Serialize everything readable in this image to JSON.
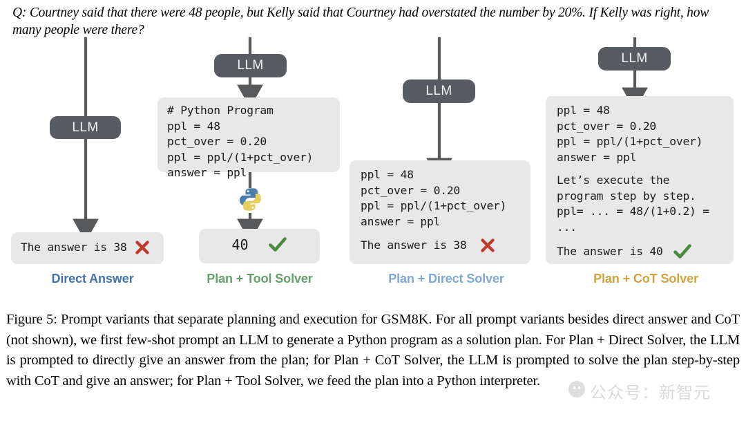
{
  "question": "Q: Courtney said that there were 48 people, but Kelly said that Courtney had overstated the number by 20%. If Kelly was right, how many people were there?",
  "llm_label": "LLM",
  "colors": {
    "llm_pill": "#585c60",
    "box_bg": "#e8e8e8",
    "arrow": "#58595b",
    "cross": "#c0392b",
    "check": "#4a8a3d",
    "direct_answer_label": "#4273b0",
    "tool_solver_label": "#64a06a",
    "direct_solver_label": "#7fa8d4",
    "cot_solver_label": "#d3a23c"
  },
  "columns": [
    {
      "id": "direct-answer",
      "label": "Direct Answer",
      "label_color": "#4273b0",
      "llm": "LLM",
      "answer_text": "The answer is 38",
      "mark": "cross"
    },
    {
      "id": "plan-tool-solver",
      "label": "Plan + Tool Solver",
      "label_color": "#64a06a",
      "llm": "LLM",
      "code_lines": [
        "# Python Program",
        "ppl = 48",
        "pct_over = 0.20",
        "ppl = ppl/(1+pct_over)",
        "answer = ppl"
      ],
      "tool_icon": "python-logo-icon",
      "answer_text": "40",
      "mark": "check"
    },
    {
      "id": "plan-direct-solver",
      "label": "Plan + Direct Solver",
      "label_color": "#7fa8d4",
      "llm": "LLM",
      "code_lines": [
        "ppl = 48",
        "pct_over = 0.20",
        "ppl = ppl/(1+pct_over)",
        "answer = ppl"
      ],
      "answer_text": "The answer is 38",
      "mark": "cross"
    },
    {
      "id": "plan-cot-solver",
      "label": "Plan + CoT Solver",
      "label_color": "#d3a23c",
      "llm": "LLM",
      "code_lines": [
        "ppl = 48",
        "pct_over = 0.20",
        "ppl = ppl/(1+pct_over)",
        "answer = ppl"
      ],
      "reasoning_lines": [
        "Let’s execute the",
        "program step by step.",
        "ppl= ... = 48/(1+0.2) =",
        "..."
      ],
      "answer_text": "The answer is 40",
      "mark": "check"
    }
  ],
  "caption": "Figure 5: Prompt variants that separate planning and execution for GSM8K. For all prompt variants besides direct answer and CoT (not shown), we first few-shot prompt an LLM to generate a Python program as a solution plan.  For Plan + Direct Solver, the LLM is prompted to directly give an answer from the plan; for Plan + CoT Solver, the LLM is prompted to solve the plan step-by-step with CoT and give an answer; for Plan + Tool Solver, we feed the plan into a Python interpreter.",
  "watermark": "公众号：新智元"
}
